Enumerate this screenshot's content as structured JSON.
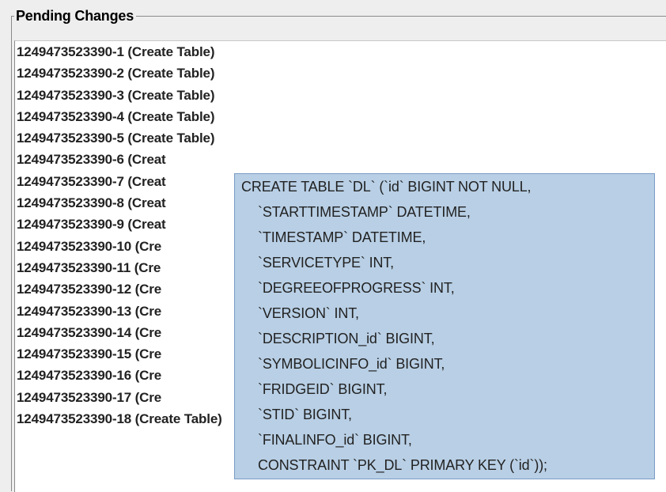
{
  "panel": {
    "title": "Pending Changes"
  },
  "changes": [
    "1249473523390-1 (Create Table)",
    "1249473523390-2 (Create Table)",
    "1249473523390-3 (Create Table)",
    "1249473523390-4 (Create Table)",
    "1249473523390-5 (Create Table)",
    "1249473523390-6 (Creat",
    "1249473523390-7 (Creat",
    "1249473523390-8 (Creat",
    "1249473523390-9 (Creat",
    "1249473523390-10 (Cre",
    "1249473523390-11 (Cre",
    "1249473523390-12 (Cre",
    "1249473523390-13 (Cre",
    "1249473523390-14 (Cre",
    "1249473523390-15 (Cre",
    "1249473523390-16 (Cre",
    "1249473523390-17 (Cre",
    "1249473523390-18 (Create Table)"
  ],
  "tooltip": {
    "lines": [
      "CREATE TABLE `DL` (`id` BIGINT NOT NULL,",
      "`STARTTIMESTAMP` DATETIME,",
      "`TIMESTAMP` DATETIME,",
      "`SERVICETYPE` INT,",
      "`DEGREEOFPROGRESS` INT,",
      "`VERSION` INT,",
      "`DESCRIPTION_id` BIGINT,",
      "`SYMBOLICINFO_id` BIGINT,",
      "`FRIDGEID` BIGINT,",
      "`STID` BIGINT,",
      "`FINALINFO_id` BIGINT,",
      "CONSTRAINT `PK_DL` PRIMARY KEY (`id`));"
    ]
  }
}
